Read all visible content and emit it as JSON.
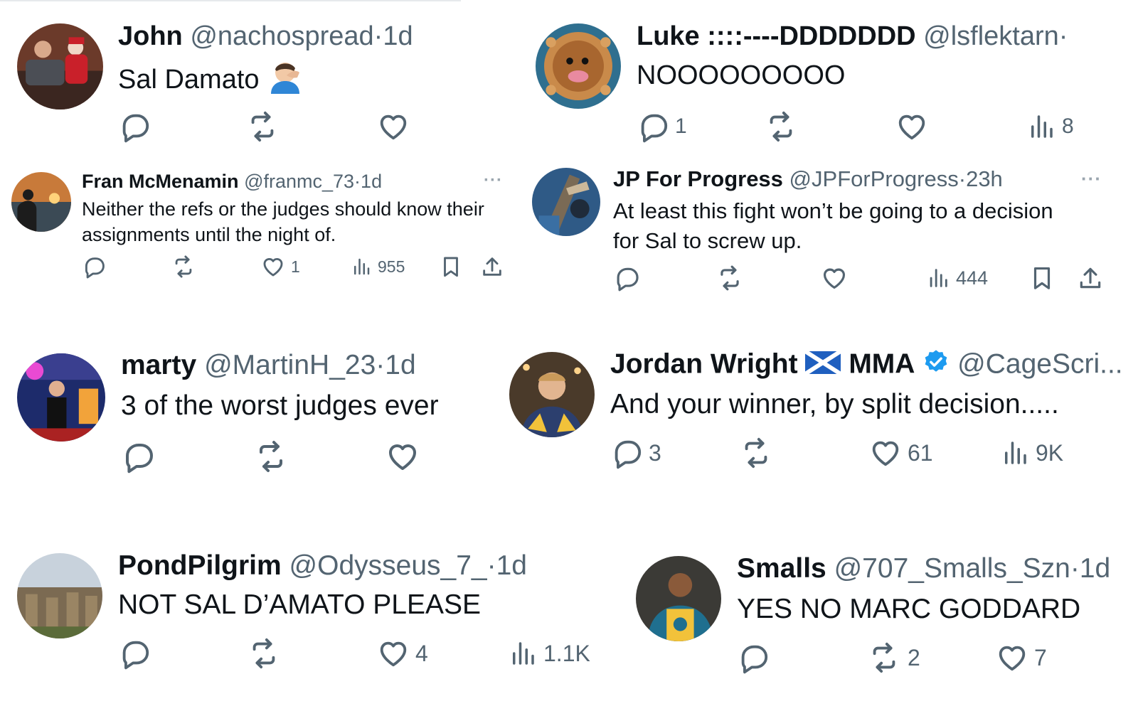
{
  "tweets": [
    {
      "name": "John",
      "handle": "@nachospread",
      "time": "1d",
      "text": "Sal Damato",
      "emoji": "facepalm-man",
      "replies": "",
      "likes": "",
      "views": ""
    },
    {
      "name": "Luke ::::----DDDDDDD",
      "handle": "@lsflektarn",
      "time": "",
      "text": "NOOOOOOOOO",
      "replies": "1",
      "likes": "",
      "views": "8"
    },
    {
      "name": "Fran McMenamin",
      "handle": "@franmc_73",
      "time": "1d",
      "text_line1": "Neither the refs or the judges should know their",
      "text_line2": "assignments until the night of.",
      "replies": "",
      "likes": "1",
      "views": "955",
      "more": "···"
    },
    {
      "name": "JP For Progress",
      "handle": "@JPForProgress",
      "time": "23h",
      "text_line1": "At least this fight won’t be going to a decision",
      "text_line2": "for Sal to screw up.",
      "replies": "",
      "likes": "",
      "views": "444",
      "more": "···"
    },
    {
      "name": "marty",
      "handle": "@MartinH_23",
      "time": "1d",
      "text": "3 of the worst judges ever",
      "replies": "",
      "likes": "",
      "views": ""
    },
    {
      "name_part1": "Jordan Wright",
      "name_part2": "MMA",
      "handle": "@CageScri...",
      "text": "And your winner, by split decision.....",
      "replies": "3",
      "likes": "61",
      "views": "9K",
      "flag": "scotland-flag",
      "verified": true
    },
    {
      "name": "PondPilgrim",
      "handle": "@Odysseus_7_",
      "time": "1d",
      "text": "NOT SAL D’AMATO PLEASE",
      "replies": "",
      "likes": "4",
      "views": "1.1K"
    },
    {
      "name": "Smalls",
      "handle": "@707_Smalls_Szn",
      "time": "1d",
      "text": "YES NO MARC GODDARD",
      "replies": "",
      "retweets": "2",
      "likes": "7"
    }
  ],
  "separator": "·",
  "colors": {
    "text": "#0f1419",
    "muted": "#536471",
    "verified": "#1d9bf0",
    "background": "#ffffff"
  }
}
